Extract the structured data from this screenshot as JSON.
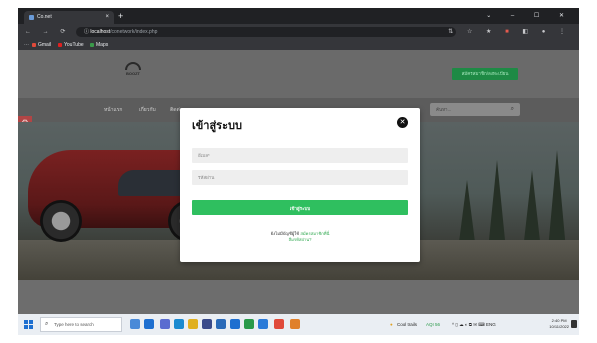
{
  "browser": {
    "tab_title": "Co.net",
    "tab_close": "×",
    "new_tab": "+",
    "window_controls": "⌄ – ☐ ✕",
    "nav_buttons": "← → ⟳",
    "url_scheme_icon": "ⓘ",
    "url_host": "localhost",
    "url_path": "/conetwork/index.php",
    "toolbar_icons": "⇅ ☆ ★",
    "toolbar_icon_accent": "■",
    "toolbar_more": "◧ ● ⋮",
    "bookmarks": [
      "Gmail",
      "YouTube",
      "Maps"
    ],
    "bookmark_prefix": "⋯"
  },
  "site": {
    "logo_text": "BOOZT",
    "register_button": "สมัครสมาชิก/ลงทะเบียน",
    "nav": [
      "หน้าแรก",
      "เกี่ยวกับ",
      "ติดต่อ"
    ],
    "search_placeholder": "ค้นหา...",
    "search_icon_glyph": "⌕",
    "settings_glyph": "⚙"
  },
  "modal": {
    "title": "เข้าสู่ระบบ",
    "close_glyph": "✕",
    "username_placeholder": "อีเมล*",
    "password_placeholder": "รหัสผ่าน",
    "login_button": "เข้าสู่ระบบ",
    "signup_prompt": "ยังไม่มีบัญชีผู้ใช้",
    "signup_link": "สมัครสมาชิกที่นี่",
    "forgot_link": "ลืมรหัสผ่าน?"
  },
  "taskbar": {
    "search_placeholder": "Type here to search",
    "search_glyph": "⌕",
    "weather": "Cool trails",
    "aqi": "AQI 56",
    "tray_icons": "^ ▯ ☁ ◐ ⧉ ✉ ⌨ ENG",
    "time": "2:40 PM",
    "date": "10/11/2022"
  },
  "colors": {
    "accent_green": "#2fbf5f",
    "register_green": "#1e8a45",
    "settings_red": "#b14545",
    "windows_blue": "#1e6fd0"
  }
}
